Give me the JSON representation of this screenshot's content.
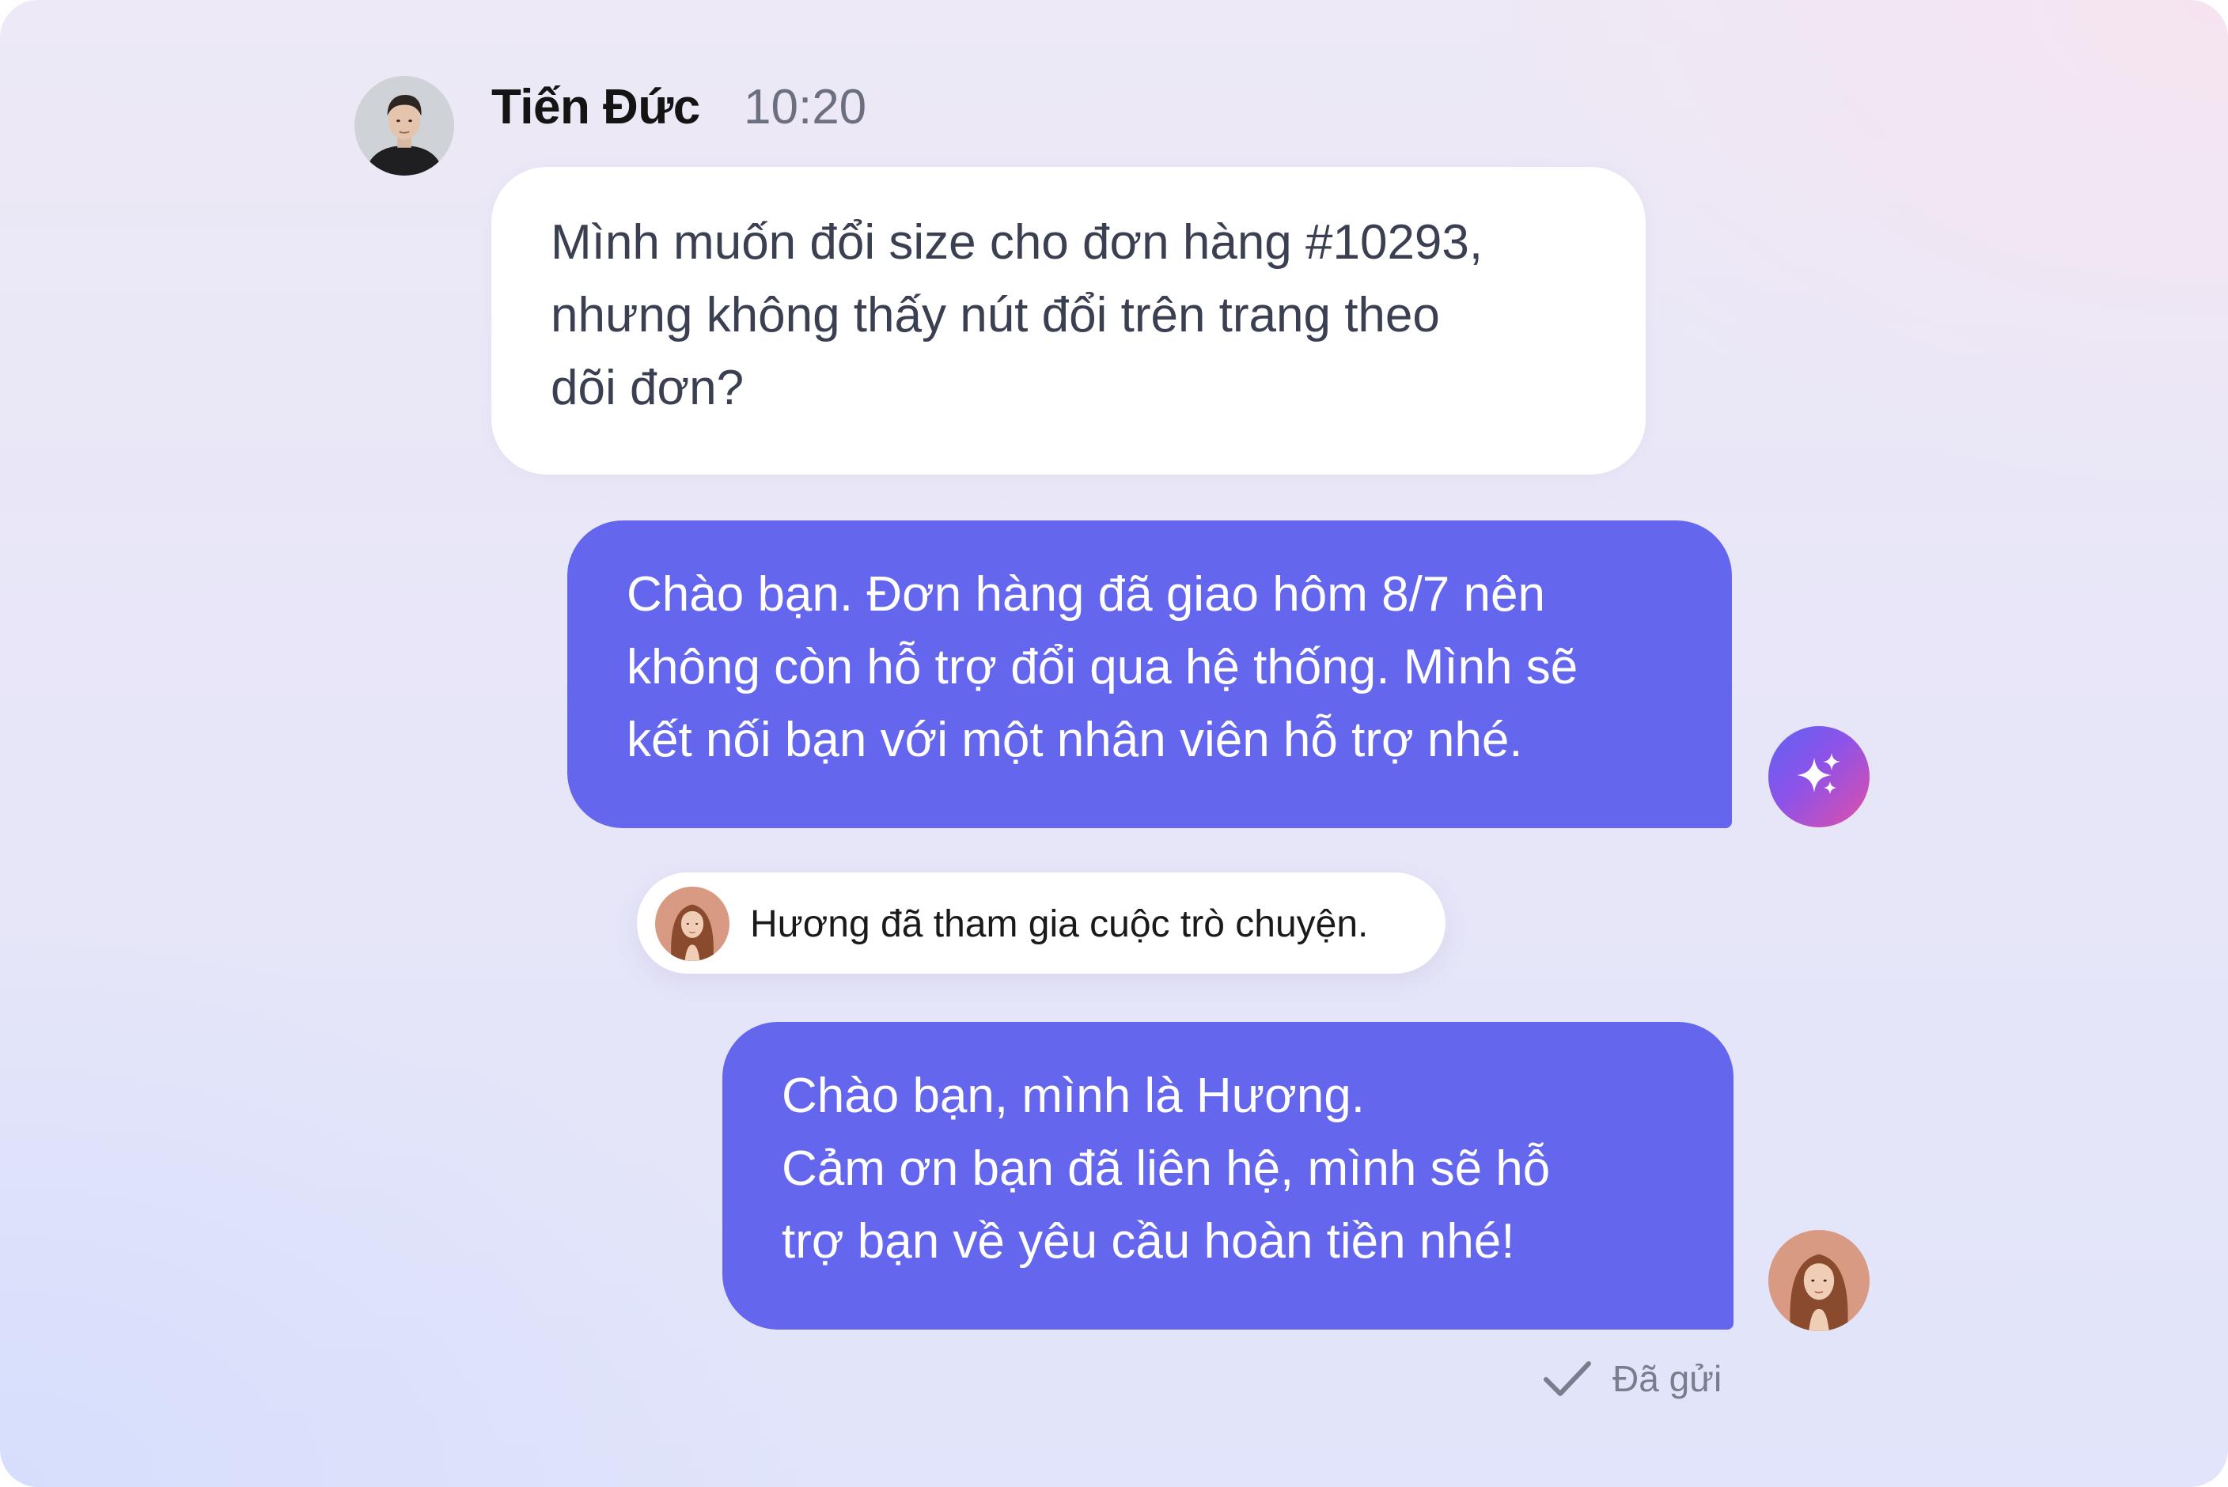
{
  "conversation": {
    "customer": {
      "name": "Tiến Đức",
      "time": "10:20"
    },
    "messages": [
      {
        "text": "Mình muốn đổi size cho đơn hàng #10293,\nnhưng không thấy nút đổi trên trang theo\ndõi đơn?"
      },
      {
        "text": "Chào bạn. Đơn hàng đã giao hôm 8/7 nên\nkhông còn hỗ trợ đổi qua hệ thống. Mình sẽ\nkết nối bạn với một nhân viên hỗ trợ nhé."
      },
      {
        "text": "Chào bạn, mình là Hương.\nCảm ơn bạn đã liên hệ, mình sẽ hỗ\ntrợ bạn về yêu cầu hoàn tiền nhé!"
      }
    ],
    "system_notice": "Hương đã tham gia cuộc trò chuyện.",
    "delivery_status": "Đã gửi",
    "icons": {
      "ai": "sparkle-icon",
      "status": "check-icon"
    },
    "colors": {
      "agent_bubble": "#6466ee",
      "customer_bubble": "#ffffff"
    }
  }
}
